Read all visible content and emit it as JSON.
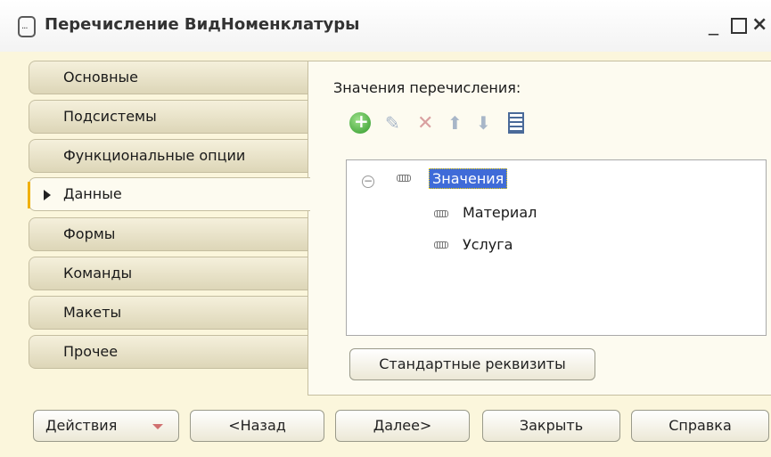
{
  "window": {
    "title": "Перечисление ВидНоменклатуры",
    "controls": {
      "minimize": "_",
      "close": "×"
    }
  },
  "tabs": [
    {
      "label": "Основные",
      "active": false
    },
    {
      "label": "Подсистемы",
      "active": false
    },
    {
      "label": "Функциональные опции",
      "active": false
    },
    {
      "label": "Данные",
      "active": true
    },
    {
      "label": "Формы",
      "active": false
    },
    {
      "label": "Команды",
      "active": false
    },
    {
      "label": "Макеты",
      "active": false
    },
    {
      "label": "Прочее",
      "active": false
    }
  ],
  "panel": {
    "label": "Значения перечисления:",
    "toolbar": {
      "icons": [
        "add-icon",
        "edit-icon",
        "delete-icon",
        "move-up-icon",
        "move-down-icon",
        "list-icon"
      ]
    },
    "tree": {
      "root": {
        "label": "Значения",
        "expanded": true,
        "selected": true
      },
      "items": [
        "Материал",
        "Услуга"
      ]
    },
    "standard_attributes_button": "Стандартные реквизиты"
  },
  "footer": {
    "actions": "Действия",
    "back": "<Назад",
    "next": "Далее>",
    "close": "Закрыть",
    "help": "Справка"
  },
  "colors": {
    "background": "#fbf6dc",
    "selection": "#3f6bd8",
    "active_marker": "#f0b000"
  }
}
